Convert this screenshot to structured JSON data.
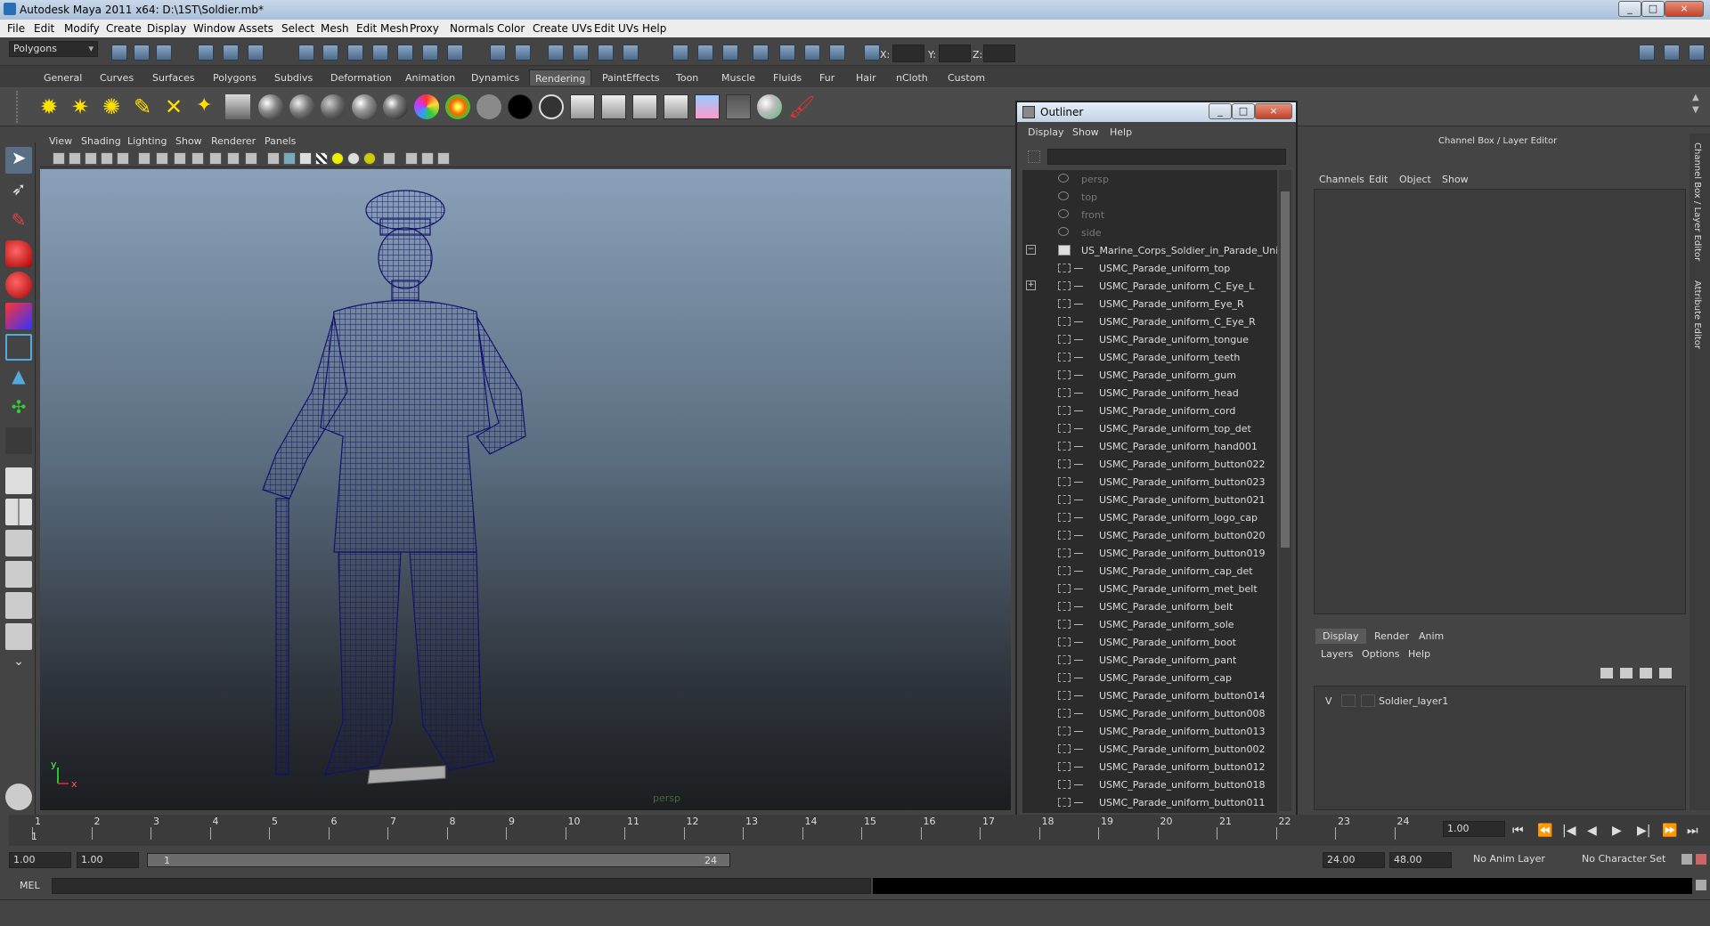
{
  "window": {
    "title": "Autodesk Maya 2011 x64: D:\\1ST\\Soldier.mb*",
    "controls": [
      "_",
      "□",
      "×"
    ]
  },
  "menubar": [
    "File",
    "Edit",
    "Modify",
    "Create",
    "Display",
    "Window",
    "Assets",
    "Select",
    "Mesh",
    "Edit Mesh",
    "Proxy",
    "Normals",
    "Color",
    "Create UVs",
    "Edit UVs",
    "Help"
  ],
  "statusline": {
    "mode": "Polygons",
    "x_label": "X:",
    "y_label": "Y:",
    "z_label": "Z:"
  },
  "shelf_tabs": [
    "General",
    "Curves",
    "Surfaces",
    "Polygons",
    "Subdivs",
    "Deformation",
    "Animation",
    "Dynamics",
    "Rendering",
    "PaintEffects",
    "Toon",
    "Muscle",
    "Fluids",
    "Fur",
    "Hair",
    "nCloth",
    "Custom"
  ],
  "active_shelf_tab": "Rendering",
  "viewport": {
    "menu": [
      "View",
      "Shading",
      "Lighting",
      "Show",
      "Renderer",
      "Panels"
    ],
    "camera_label": "persp",
    "axis_y": "y",
    "axis_x": "x"
  },
  "outliner": {
    "title": "Outliner",
    "menu": [
      "Display",
      "Show",
      "Help"
    ],
    "cameras": [
      "persp",
      "top",
      "front",
      "side"
    ],
    "group": "US_Marine_Corps_Soldier_in_Parade_Unifor",
    "children": [
      "USMC_Parade_uniform_top",
      "USMC_Parade_uniform_C_Eye_L",
      "USMC_Parade_uniform_Eye_R",
      "USMC_Parade_uniform_C_Eye_R",
      "USMC_Parade_uniform_tongue",
      "USMC_Parade_uniform_teeth",
      "USMC_Parade_uniform_gum",
      "USMC_Parade_uniform_head",
      "USMC_Parade_uniform_cord",
      "USMC_Parade_uniform_top_det",
      "USMC_Parade_uniform_hand001",
      "USMC_Parade_uniform_button022",
      "USMC_Parade_uniform_button023",
      "USMC_Parade_uniform_button021",
      "USMC_Parade_uniform_logo_cap",
      "USMC_Parade_uniform_button020",
      "USMC_Parade_uniform_button019",
      "USMC_Parade_uniform_cap_det",
      "USMC_Parade_uniform_met_belt",
      "USMC_Parade_uniform_belt",
      "USMC_Parade_uniform_sole",
      "USMC_Parade_uniform_boot",
      "USMC_Parade_uniform_pant",
      "USMC_Parade_uniform_cap",
      "USMC_Parade_uniform_button014",
      "USMC_Parade_uniform_button008",
      "USMC_Parade_uniform_button013",
      "USMC_Parade_uniform_button002",
      "USMC_Parade_uniform_button012",
      "USMC_Parade_uniform_button018",
      "USMC_Parade_uniform_button011"
    ]
  },
  "channel_box": {
    "title": "Channel Box / Layer Editor",
    "menu": [
      "Channels",
      "Edit",
      "Object",
      "Show"
    ],
    "tabs": [
      "Display",
      "Render",
      "Anim"
    ],
    "layer_menu": [
      "Layers",
      "Options",
      "Help"
    ],
    "layer": {
      "visible": "V",
      "name": "Soldier_layer1"
    }
  },
  "side_tabs": [
    "Channel Box / Layer Editor",
    "Attribute Editor"
  ],
  "timeline": {
    "frames": [
      "1",
      "2",
      "3",
      "4",
      "5",
      "6",
      "7",
      "8",
      "9",
      "10",
      "11",
      "12",
      "13",
      "14",
      "15",
      "16",
      "17",
      "18",
      "19",
      "20",
      "21",
      "22",
      "23",
      "24"
    ],
    "current_frame_marker": "1",
    "current_frame": "1.00",
    "playback_buttons": [
      "⏮",
      "⏪",
      "|◀",
      "◀",
      "▶",
      "▶|",
      "⏩",
      "⏭"
    ]
  },
  "range": {
    "start": "1.00",
    "playback_start": "1.00",
    "slider_start": "1",
    "slider_end": "24",
    "playback_end": "24.00",
    "end": "48.00",
    "anim_layer": "No Anim Layer",
    "character_set": "No Character Set"
  },
  "command_line": {
    "label": "MEL"
  },
  "colors": {
    "viewport_top": "#8aa1b9",
    "viewport_bottom": "#1b1d20",
    "wireframe": "#1a1a7a",
    "panel": "#444444"
  }
}
